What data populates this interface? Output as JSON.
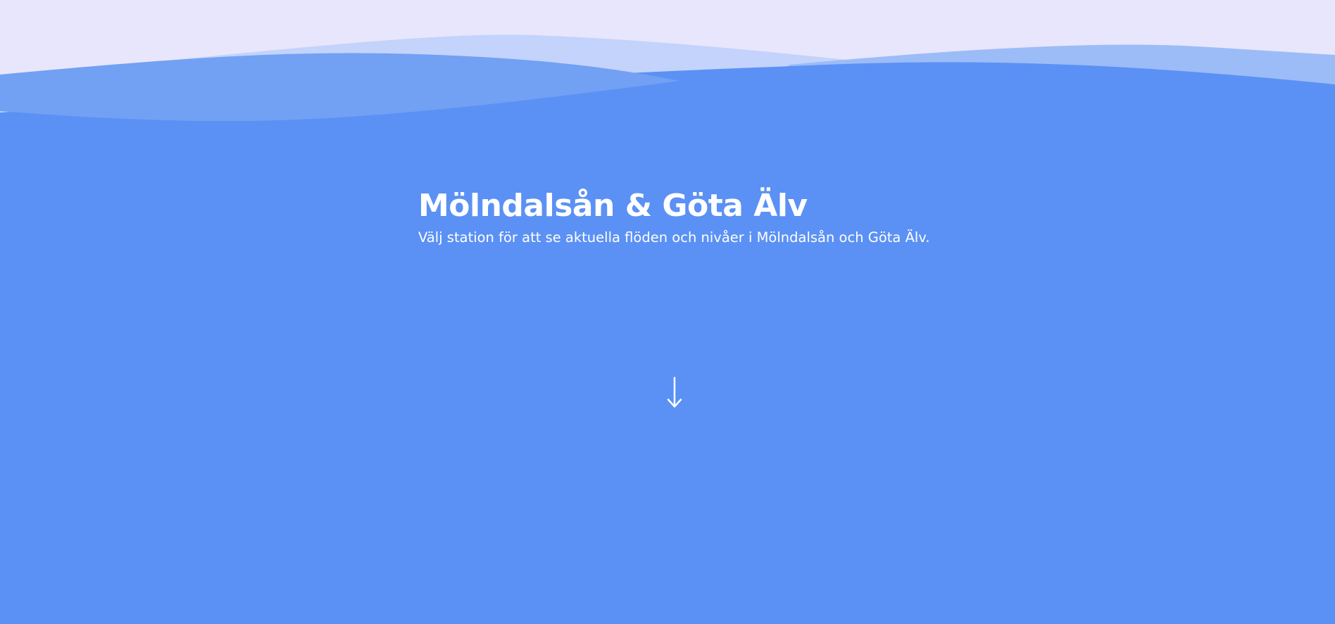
{
  "hero": {
    "title": "Mölndalsån & Göta Älv",
    "subtitle": "Välj station för att se aktuella flöden och nivåer i Mölndalsån och Göta Älv."
  },
  "icons": {
    "scroll_down": "arrow-down-icon"
  },
  "colors": {
    "background": "#5b91f5",
    "sky": "#e8e6fc",
    "wave_light": "#c3d3fb",
    "wave_mid": "#9cbcf8",
    "wave_front": "#72a0f3",
    "text": "#ffffff"
  }
}
